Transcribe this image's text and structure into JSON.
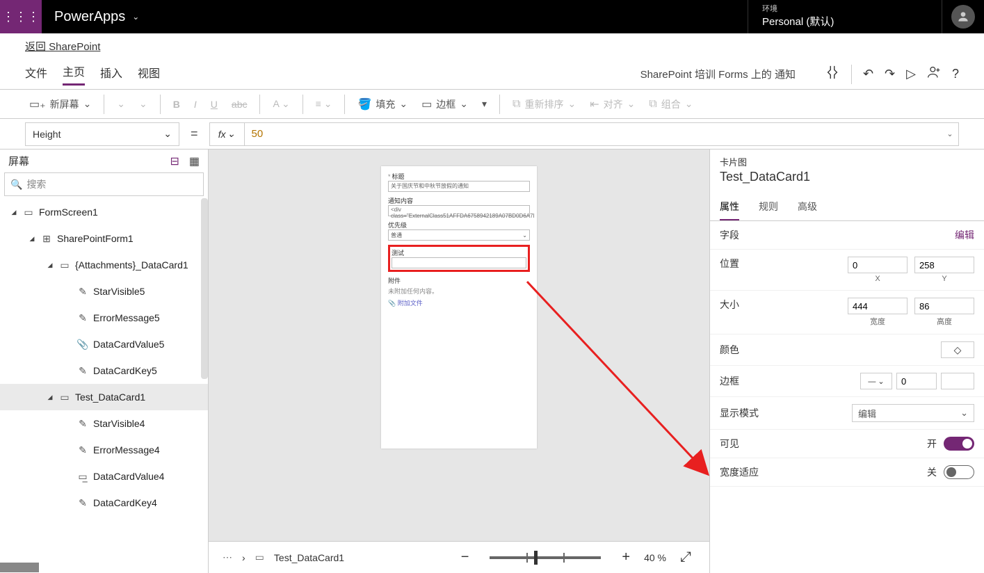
{
  "header": {
    "app": "PowerApps",
    "envLabel": "环境",
    "envName": "Personal (默认)"
  },
  "backLink": "返回 SharePoint",
  "menu": {
    "tabs": {
      "file": "文件",
      "home": "主页",
      "insert": "插入",
      "view": "视图"
    },
    "docName": "SharePoint 培训 Forms 上的 通知"
  },
  "toolbar": {
    "newScreen": "新屏幕",
    "fill": "填充",
    "border": "边框",
    "reorder": "重新排序",
    "align": "对齐",
    "group": "组合"
  },
  "formulaBar": {
    "property": "Height",
    "value": "50"
  },
  "treeHeader": "屏幕",
  "searchPlaceholder": "搜索",
  "tree": [
    {
      "name": "FormScreen1",
      "depth": 0,
      "icon": "▭",
      "exp": true
    },
    {
      "name": "SharePointForm1",
      "depth": 1,
      "icon": "⊞",
      "exp": true
    },
    {
      "name": "{Attachments}_DataCard1",
      "depth": 2,
      "icon": "▭",
      "exp": true
    },
    {
      "name": "StarVisible5",
      "depth": 3,
      "icon": "✎"
    },
    {
      "name": "ErrorMessage5",
      "depth": 3,
      "icon": "✎"
    },
    {
      "name": "DataCardValue5",
      "depth": 3,
      "icon": "📎"
    },
    {
      "name": "DataCardKey5",
      "depth": 3,
      "icon": "✎"
    },
    {
      "name": "Test_DataCard1",
      "depth": 2,
      "icon": "▭",
      "exp": true,
      "selected": true
    },
    {
      "name": "StarVisible4",
      "depth": 3,
      "icon": "✎"
    },
    {
      "name": "ErrorMessage4",
      "depth": 3,
      "icon": "✎"
    },
    {
      "name": "DataCardValue4",
      "depth": 3,
      "icon": "▭̲"
    },
    {
      "name": "DataCardKey4",
      "depth": 3,
      "icon": "✎"
    }
  ],
  "preview": {
    "f1": {
      "label": "标题",
      "value": "关于国庆节和中秋节放假的通知"
    },
    "f2": {
      "label": "通知内容",
      "value": "<div class=\"ExternalClass51AFFDA6758942189A07BD0D6A7I"
    },
    "f3": {
      "label": "优先级",
      "value": "普通"
    },
    "f4": {
      "label": "测试"
    },
    "att": {
      "label": "附件",
      "empty": "未附加任何内容。",
      "add": "📎 附加文件"
    }
  },
  "breadcrumb": "Test_DataCard1",
  "zoom": "40  %",
  "props": {
    "cardKind": "卡片图",
    "cardName": "Test_DataCard1",
    "tabs": {
      "props": "属性",
      "rules": "规则",
      "advanced": "高级"
    },
    "field": {
      "label": "字段",
      "edit": "编辑"
    },
    "position": {
      "label": "位置",
      "x": "0",
      "y": "258",
      "xlabel": "X",
      "ylabel": "Y"
    },
    "size": {
      "label": "大小",
      "w": "444",
      "h": "86",
      "wlabel": "宽度",
      "hlabel": "高度"
    },
    "color": "颜色",
    "border": {
      "label": "边框",
      "value": "0"
    },
    "displayMode": {
      "label": "显示模式",
      "value": "编辑"
    },
    "visible": {
      "label": "可见",
      "value": "开"
    },
    "widthFit": {
      "label": "宽度适应",
      "value": "关"
    }
  }
}
